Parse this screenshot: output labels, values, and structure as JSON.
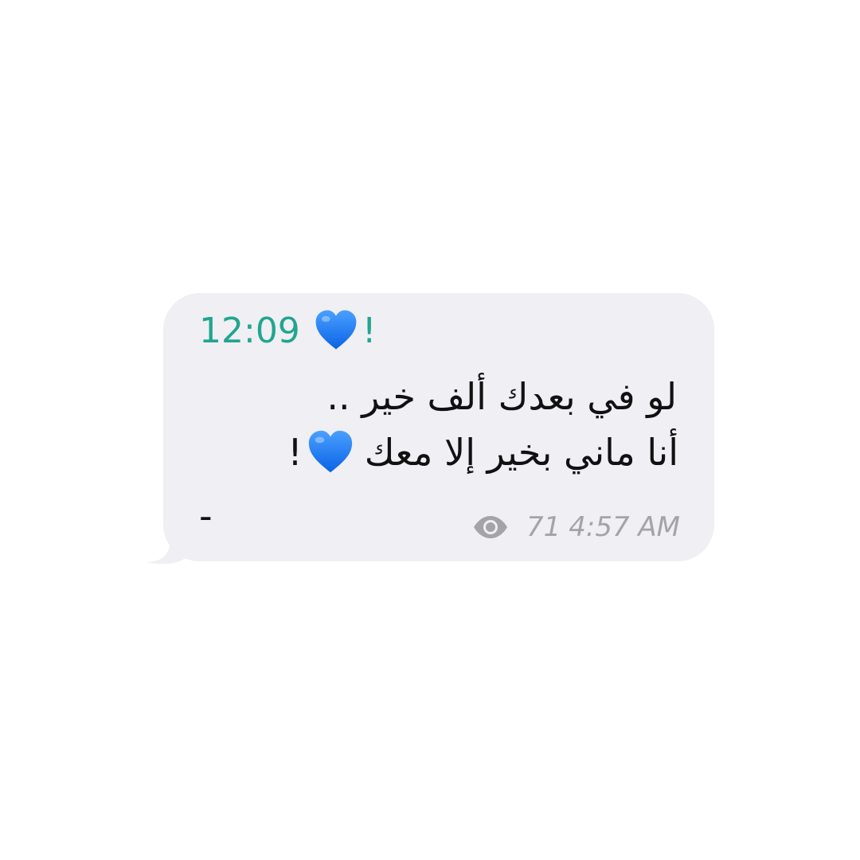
{
  "message": {
    "sender_time": "12:09",
    "sender_suffix": "!",
    "line1": "لو في بعدك ألف خير ..",
    "line2_text": "أنا ماني بخير إلا معك",
    "line2_suffix": "!",
    "trailing_mark": "-",
    "views": "71",
    "timestamp": "4:57 AM",
    "heart_icon": "blue-heart-icon",
    "eye_icon": "eye-icon"
  },
  "colors": {
    "bubble": "#efeff4",
    "sender": "#21a58f",
    "text": "#111111",
    "meta": "#a3a3a8",
    "heart": "#1f7df2"
  }
}
